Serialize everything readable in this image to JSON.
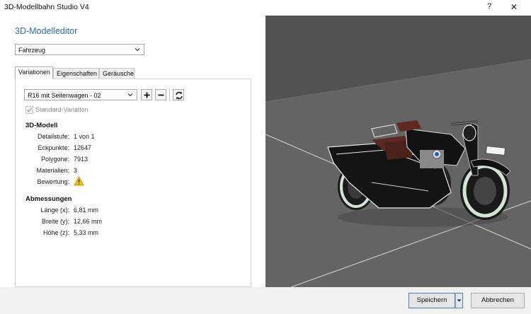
{
  "window": {
    "title": "3D-Modellbahn Studio V4",
    "help_label": "?",
    "close_label": "✕"
  },
  "editor": {
    "heading": "3D-Modelleditor",
    "category_select": "Fahrzeug",
    "tabs": [
      {
        "label": "Variationen",
        "active": true
      },
      {
        "label": "Eigenschaften",
        "active": false
      },
      {
        "label": "Geräusche",
        "active": false
      }
    ],
    "variation_select": "R16 mit Seitenwagen - 02",
    "standard_variation": {
      "label": "Standard-Variation",
      "checked": true,
      "enabled": false
    },
    "model_section": {
      "title": "3D-Modell",
      "rows": [
        {
          "label": "Detailstufe:",
          "value": "1 von 1"
        },
        {
          "label": "Eckpunkte:",
          "value": "12647"
        },
        {
          "label": "Polygone:",
          "value": "7913"
        },
        {
          "label": "Materialien:",
          "value": "3"
        },
        {
          "label": "Bewertung:",
          "value": ""
        }
      ],
      "rating_icon": "warning-icon"
    },
    "dimensions_section": {
      "title": "Abmessungen",
      "rows": [
        {
          "label": "Länge (x):",
          "value": "6,81 mm"
        },
        {
          "label": "Breite (y):",
          "value": "12,66 mm"
        },
        {
          "label": "Höhe (z):",
          "value": "5,33 mm"
        }
      ]
    }
  },
  "footer": {
    "save_label": "Speichern",
    "cancel_label": "Abbrechen"
  },
  "colors": {
    "accent": "#2a6fb0",
    "viewport_bg": "#555555",
    "ground": "#636363",
    "warning": "#f2c200"
  }
}
